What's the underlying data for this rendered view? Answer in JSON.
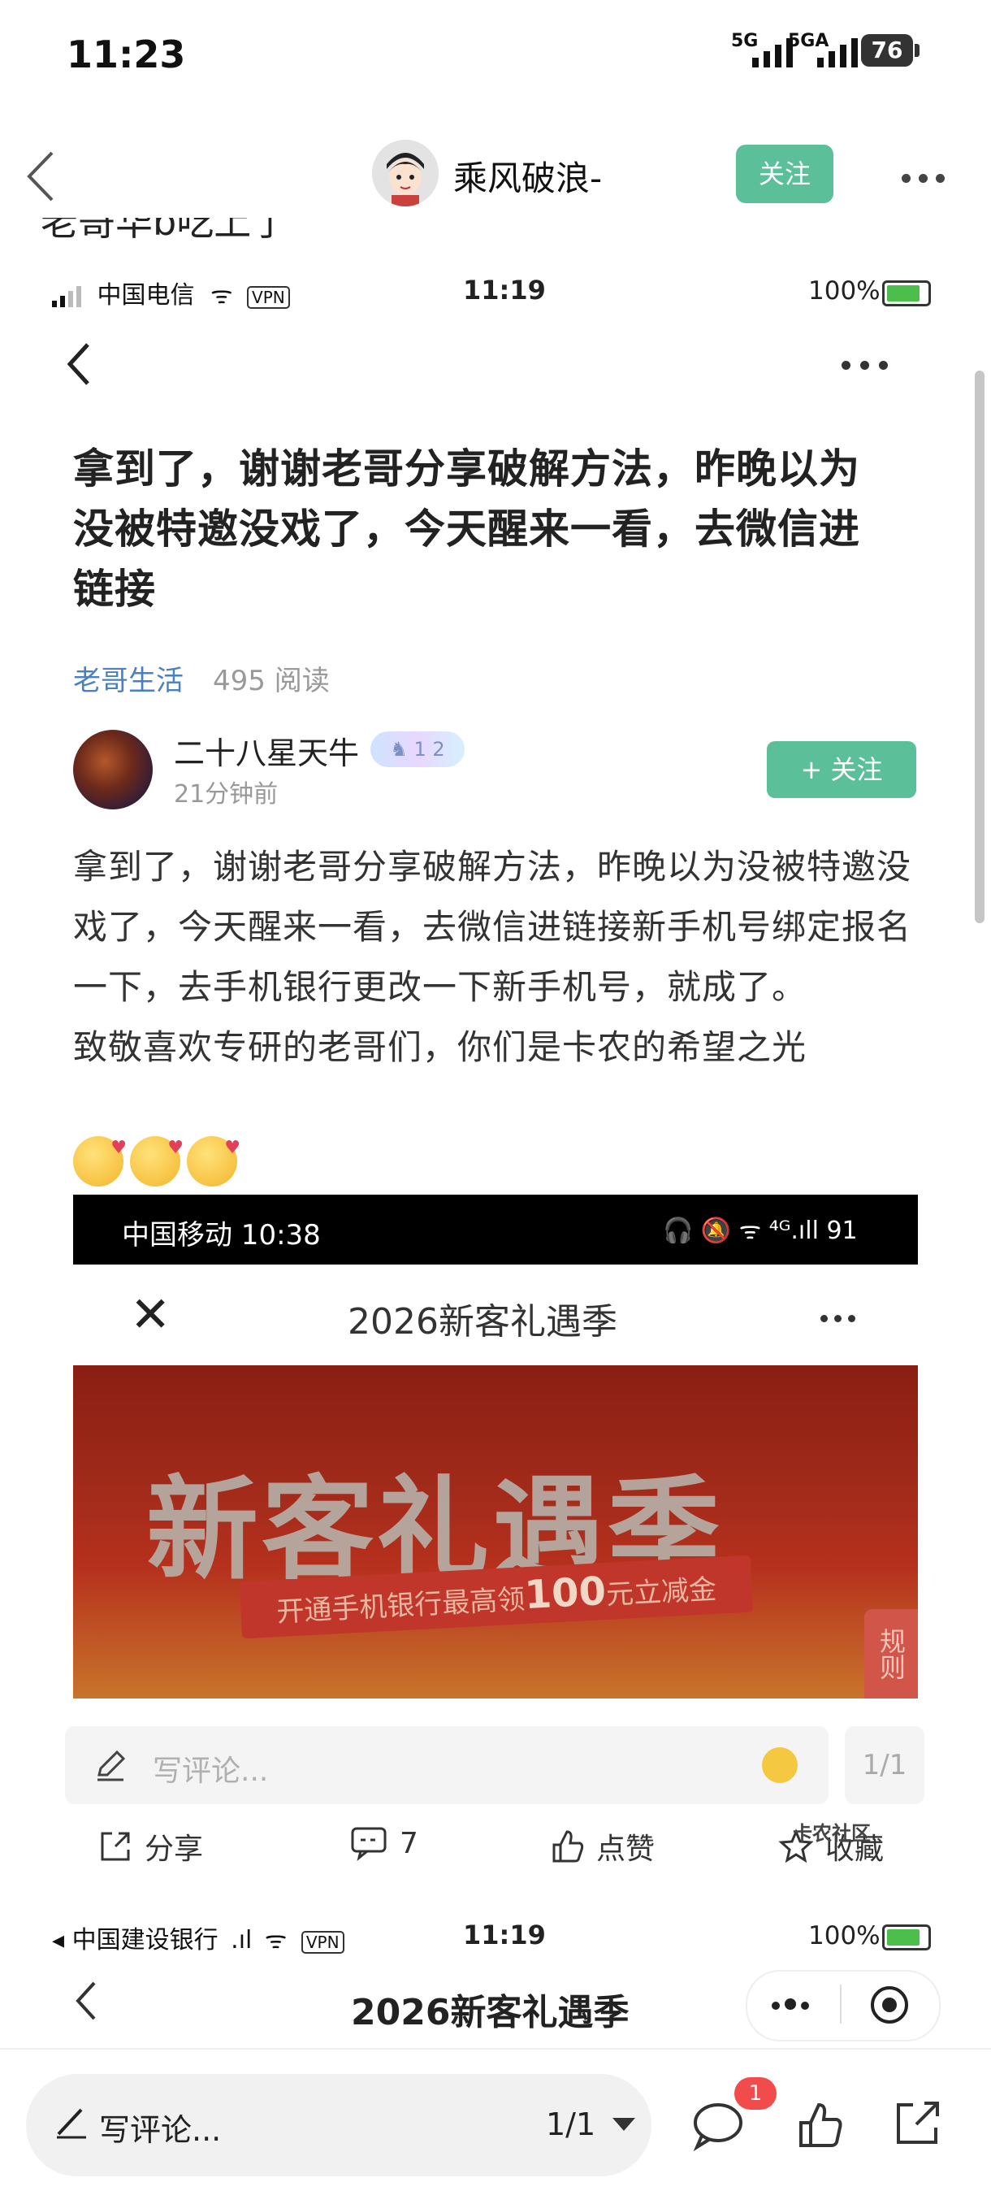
{
  "status_bar": {
    "time": "11:23",
    "network_1": "5G",
    "network_2": "5GA",
    "battery": "76"
  },
  "nav": {
    "username": "乘风破浪-",
    "follow_label": "关注"
  },
  "partial_text": "老哥华b吃上了",
  "inner": {
    "status": {
      "carrier": "中国电信",
      "vpn": "VPN",
      "time": "11:19",
      "battery": "100%"
    },
    "post": {
      "title": "拿到了，谢谢老哥分享破解方法，昨晚以为没被特邀没戏了，今天醒来一看，去微信进链接",
      "category": "老哥生活",
      "reads": "495 阅读",
      "author": "二十八星天牛",
      "author_badge": "♞ 1 2",
      "posted_ago": "21分钟前",
      "follow_label": "+ 关注",
      "body": "拿到了，谢谢老哥分享破解方法，昨晚以为没被特邀没戏了，今天醒来一看，去微信进链接新手机号绑定报名一下，去手机银行更改一下新手机号，就成了。",
      "body_2": "致敬喜欢专研的老哥们，你们是卡农的希望之光"
    },
    "embedded": {
      "carrier_time": "中国移动 10:38",
      "status_icons": "🎧 🔕 ᯤ ⁴ᴳ.ıll 91",
      "page_title": "2026新客礼遇季",
      "banner_title": "新客礼遇季",
      "banner_sub_pre": "开通手机银行最高领",
      "banner_sub_amount": "100",
      "banner_sub_post": "元立减金",
      "banner_rule": "规则"
    },
    "comment_placeholder": "写评论...",
    "page_indicator": "1/1",
    "actions": {
      "share": "分享",
      "comments": "7",
      "like": "点赞",
      "favorite": "收藏"
    },
    "watermark": "卡农社区",
    "status2": {
      "carrier": "◂ 中国建设银行",
      "vpn": "VPN",
      "time": "11:19",
      "battery": "100%"
    },
    "nav2_title": "2026新客礼遇季"
  },
  "bottom": {
    "comment_label": "写评论...",
    "page_indicator": "1/1",
    "comment_badge": "1"
  },
  "colors": {
    "accent_green": "#5bbf9a",
    "link_blue": "#4a7fc1",
    "badge_red": "#f24b4b"
  }
}
